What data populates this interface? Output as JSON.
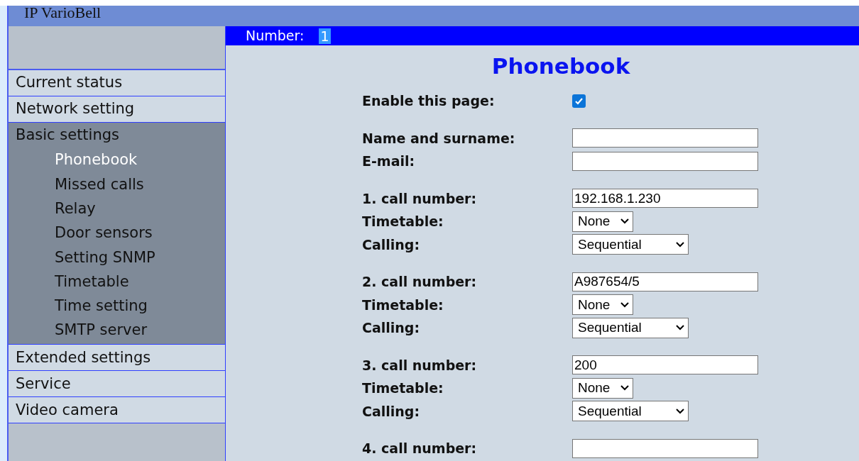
{
  "header": {
    "title": "IP VarioBell"
  },
  "sidebar": {
    "items": [
      {
        "label": "Current status",
        "expanded": false
      },
      {
        "label": "Network setting",
        "expanded": false
      },
      {
        "label": "Basic settings",
        "expanded": true,
        "children": [
          {
            "label": "Phonebook",
            "selected": true
          },
          {
            "label": "Missed calls",
            "selected": false
          },
          {
            "label": "Relay",
            "selected": false
          },
          {
            "label": "Door sensors",
            "selected": false
          },
          {
            "label": "Setting SNMP",
            "selected": false
          },
          {
            "label": "Timetable",
            "selected": false
          },
          {
            "label": "Time setting",
            "selected": false
          },
          {
            "label": "SMTP server",
            "selected": false
          }
        ]
      },
      {
        "label": "Extended settings",
        "expanded": false
      },
      {
        "label": "Service",
        "expanded": false
      },
      {
        "label": "Video camera",
        "expanded": false
      }
    ]
  },
  "number_bar": {
    "label": "Number:",
    "value": "1"
  },
  "page_title": "Phonebook",
  "form_groups": [
    [
      {
        "kind": "checkbox",
        "label": "Enable this page:",
        "checked": true
      }
    ],
    [
      {
        "kind": "text",
        "label": "Name and surname:"
      },
      {
        "kind": "text",
        "label": "E-mail:"
      }
    ],
    [
      {
        "kind": "text",
        "label": "1. call number:",
        "value": "192.168.1.230"
      },
      {
        "kind": "select",
        "label": "Timetable:",
        "value": "None"
      },
      {
        "kind": "dropdown",
        "label": "Calling:",
        "value": "Sequential"
      }
    ],
    [
      {
        "kind": "text",
        "label": "2. call number:",
        "value": "A987654/5"
      },
      {
        "kind": "select",
        "label": "Timetable:",
        "value": "None"
      },
      {
        "kind": "dropdown",
        "label": "Calling:",
        "value": "Sequential"
      }
    ],
    [
      {
        "kind": "text",
        "label": "3. call number:",
        "value": "200"
      },
      {
        "kind": "select",
        "label": "Timetable:",
        "value": "None"
      },
      {
        "kind": "dropdown",
        "label": "Calling:",
        "value": "Sequential"
      }
    ],
    [
      {
        "kind": "text",
        "label": "4. call number:"
      }
    ]
  ]
}
